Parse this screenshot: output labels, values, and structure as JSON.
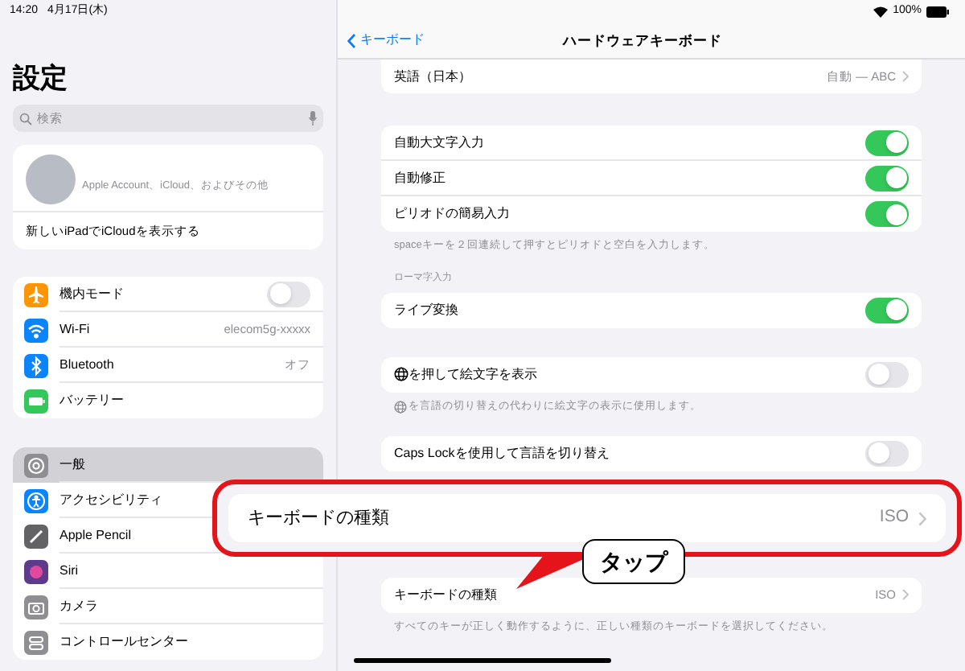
{
  "status_bar": {
    "time": "14:20",
    "date": "4月17日(木)",
    "battery": "100%"
  },
  "sidebar": {
    "title": "設定",
    "search": {
      "placeholder": "検索"
    },
    "account": {
      "subtitle": "Apple Account、iCloud、およびその他",
      "link": "新しいiPadでiCloudを表示する"
    },
    "groups": [
      [
        {
          "label": "機内モード",
          "color": "#ff9500",
          "kind": "toggle",
          "on": false,
          "selected": false
        },
        {
          "label": "Wi-Fi",
          "color": "#0a84ff",
          "kind": "value",
          "value": "elecom5g-xxxxx",
          "selected": false
        },
        {
          "label": "Bluetooth",
          "color": "#0a84ff",
          "kind": "value",
          "value": "オフ",
          "selected": false
        },
        {
          "label": "バッテリー",
          "color": "#34c759",
          "kind": "plain",
          "selected": false
        }
      ],
      [
        {
          "label": "一般",
          "color": "#8e8e93",
          "kind": "plain",
          "selected": true
        },
        {
          "label": "アクセシビリティ",
          "color": "#0a84ff",
          "kind": "plain",
          "selected": false
        },
        {
          "label": "Apple Pencil",
          "color": "#636366",
          "kind": "plain",
          "selected": false
        },
        {
          "label": "Siri",
          "color": "#5e3a8c",
          "kind": "plain",
          "selected": false
        },
        {
          "label": "カメラ",
          "color": "#8e8e93",
          "kind": "plain",
          "selected": false
        },
        {
          "label": "コントロールセンター",
          "color": "#8e8e93",
          "kind": "plain",
          "selected": false
        }
      ]
    ]
  },
  "detail": {
    "back": "キーボード",
    "title": "ハードウェアキーボード",
    "groups": [
      {
        "rows": [
          {
            "label": "英語（日本）",
            "kind": "value",
            "value": "自動 ― ABC"
          }
        ]
      },
      {
        "rows": [
          {
            "label": "自動大文字入力",
            "kind": "toggle",
            "on": true
          },
          {
            "label": "自動修正",
            "kind": "toggle",
            "on": true
          },
          {
            "label": "ピリオドの簡易入力",
            "kind": "toggle",
            "on": true
          }
        ],
        "footer": {
          "text": "spaceキーを２回連続して押すとピリオドと空白を入力します。",
          "globe": false
        }
      },
      {
        "header": "ローマ字入力",
        "rows": [
          {
            "label": "ライブ変換",
            "kind": "toggle",
            "on": true
          }
        ]
      },
      {
        "rows": [
          {
            "label": "を押して絵文字を表示",
            "kind": "toggle",
            "on": false,
            "globe": true
          }
        ],
        "footer": {
          "text": "を言語の切り替えの代わりに絵文字の表示に使用します。",
          "globe": true
        }
      },
      {
        "rows": [
          {
            "label": "Caps Lockを使用して言語を切り替え",
            "kind": "toggle",
            "on": false
          }
        ]
      },
      {
        "rows": [
          {
            "label": "キーボードの種類",
            "kind": "value",
            "value": "ISO"
          }
        ],
        "footer": {
          "text": "すべてのキーが正しく動作するように、正しい種類のキーボードを選択してください。",
          "globe": false
        }
      }
    ]
  },
  "callout": {
    "label": "キーボードの種類",
    "value": "ISO",
    "bubble": "タップ"
  }
}
